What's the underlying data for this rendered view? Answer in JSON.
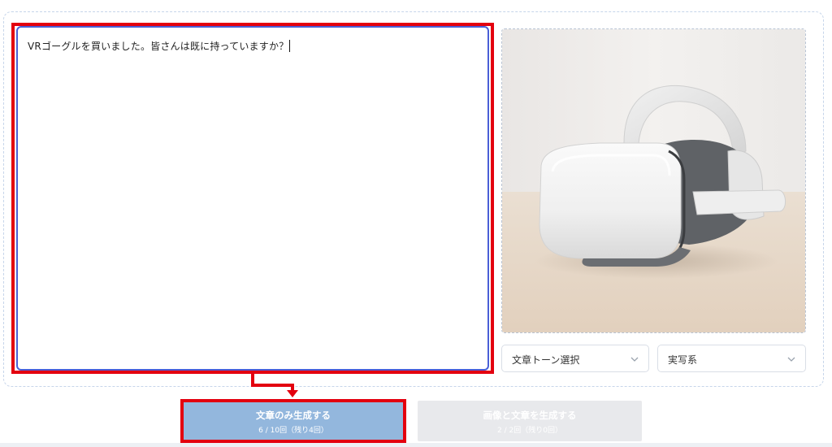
{
  "editor": {
    "text": "VRゴーグルを買いました。皆さんは既に持っていますか？"
  },
  "preview": {
    "subject": "vr-headset-photo",
    "colors": {
      "wall": "#eeeceb",
      "table": "#e7d8c8",
      "headset": "#f2f2f2",
      "face_cushion": "#5e6165"
    }
  },
  "selects": {
    "tone": {
      "label": "文章トーン選択"
    },
    "style": {
      "label": "実写系"
    }
  },
  "buttons": {
    "text_only": {
      "label": "文章のみ生成する",
      "sub": "6 / 10回（残り4回）"
    },
    "image_and_text": {
      "label": "画像と文章を生成する",
      "sub": "2 / 2回（残り0回）"
    }
  },
  "colors": {
    "highlight": "#e3000f",
    "primary_button": "#93b7dd",
    "disabled_button": "#e8e9ec",
    "editor_border": "#4a5fd6"
  }
}
